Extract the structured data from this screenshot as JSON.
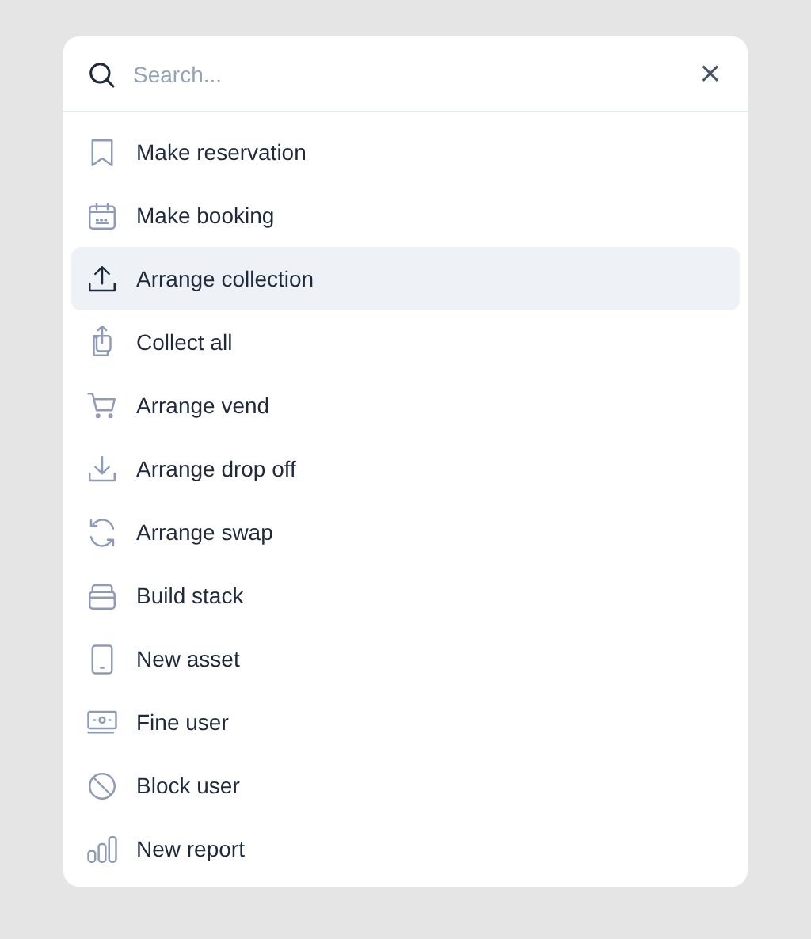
{
  "search": {
    "placeholder": "Search..."
  },
  "clear_button": "×",
  "items": [
    {
      "label": "Make reservation",
      "selected": false
    },
    {
      "label": "Make booking",
      "selected": false
    },
    {
      "label": "Arrange collection",
      "selected": true
    },
    {
      "label": "Collect all",
      "selected": false
    },
    {
      "label": "Arrange vend",
      "selected": false
    },
    {
      "label": "Arrange drop off",
      "selected": false
    },
    {
      "label": "Arrange swap",
      "selected": false
    },
    {
      "label": "Build stack",
      "selected": false
    },
    {
      "label": "New asset",
      "selected": false
    },
    {
      "label": "Fine user",
      "selected": false
    },
    {
      "label": "Block user",
      "selected": false
    },
    {
      "label": "New report",
      "selected": false
    }
  ]
}
